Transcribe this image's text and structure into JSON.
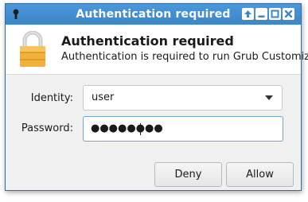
{
  "window": {
    "title": "Authentication required",
    "controls": [
      "up-arrow-icon",
      "minimize-icon",
      "maximize-icon",
      "close-icon"
    ]
  },
  "header": {
    "heading": "Authentication required",
    "message": "Authentication is required to run Grub Customizer",
    "icon": "lock-icon"
  },
  "form": {
    "identity_label": "Identity:",
    "identity_value": "user",
    "password_label": "Password:",
    "password_value": "●●●●●●●●"
  },
  "buttons": {
    "deny": "Deny",
    "allow": "Allow"
  },
  "colors": {
    "titlebar": "#3d86c8",
    "lock_body": "#f0b23d",
    "lock_shackle": "#c9c9c9"
  }
}
